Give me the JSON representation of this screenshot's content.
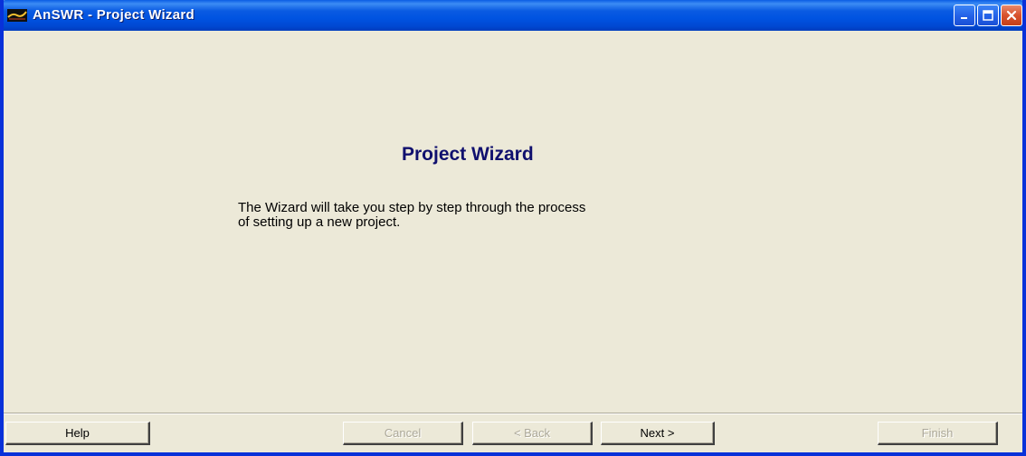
{
  "window": {
    "title": "AnSWR - Project Wizard",
    "icon": "answr-app-icon",
    "controls": [
      "minimize-icon",
      "maximize-icon",
      "close-icon"
    ]
  },
  "main": {
    "heading": "Project Wizard",
    "description_lines": [
      "The Wizard will take you step by step through the process",
      "of setting up a new project."
    ]
  },
  "buttons": {
    "help": "Help",
    "cancel": "Cancel",
    "back": "< Back",
    "next": "Next >",
    "finish": "Finish"
  },
  "colors": {
    "titlebar": "#0054e3",
    "window_bg": "#ece9d8",
    "heading": "#10106e",
    "disabled_text": "#aca899"
  }
}
